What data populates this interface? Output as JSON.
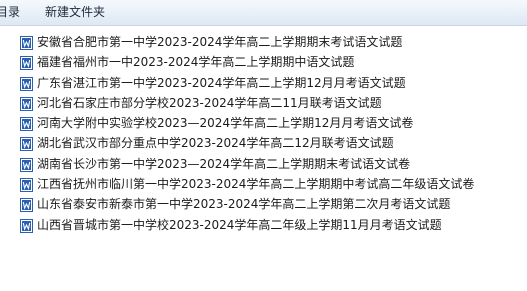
{
  "toolbar": {
    "prev_label": "目录",
    "new_folder_label": "新建文件夹"
  },
  "files": [
    {
      "name": "安徽省合肥市第一中学2023-2024学年高二上学期期末考试语文试题",
      "icon": "word-doc-icon"
    },
    {
      "name": "福建省福州市一中2023-2024学年高二上学期期中语文试题",
      "icon": "word-doc-icon"
    },
    {
      "name": "广东省湛江市第一中学2023-2024学年高二上学期12月月考语文试题",
      "icon": "word-doc-icon"
    },
    {
      "name": "河北省石家庄市部分学校2023-2024学年高二11月联考语文试题",
      "icon": "word-doc-icon"
    },
    {
      "name": "河南大学附中实验学校2023—2024学年高二上学期12月月考语文试卷",
      "icon": "word-doc-icon"
    },
    {
      "name": "湖北省武汉市部分重点中学2023-2024学年高二12月联考语文试题",
      "icon": "word-doc-icon"
    },
    {
      "name": "湖南省长沙市第一中学2023—2024学年高二上学期期末考试语文试卷",
      "icon": "word-doc-icon"
    },
    {
      "name": "江西省抚州市临川第一中学2023-2024学年高二上学期期中考试高二年级语文试卷",
      "icon": "word-doc-icon"
    },
    {
      "name": "山东省泰安市新泰市第一中学2023-2024学年高二上学期第二次月考语文试题",
      "icon": "word-doc-icon"
    },
    {
      "name": "山西省晋城市第一中学校2023-2024学年高二年级上学期11月月考语文试题",
      "icon": "word-doc-icon"
    }
  ],
  "colors": {
    "icon_blue": "#2b5fb4",
    "icon_page": "#ffffff",
    "toolbar_bg": "#e7eff8"
  }
}
